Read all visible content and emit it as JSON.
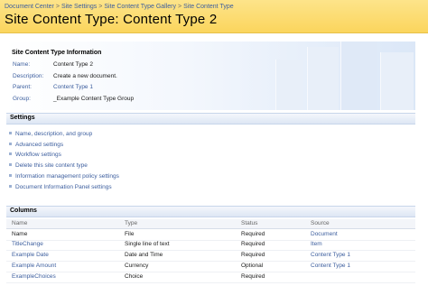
{
  "breadcrumb": {
    "items": [
      "Document Center",
      "Site Settings",
      "Site Content Type Gallery",
      "Site Content Type"
    ],
    "separator": ">"
  },
  "page_title": "Site Content Type: Content Type 2",
  "info": {
    "title": "Site Content Type Information",
    "rows": [
      {
        "label": "Name:",
        "value": "Content Type 2"
      },
      {
        "label": "Description:",
        "value": "Create a new document."
      },
      {
        "label": "Parent:",
        "value": "Content Type 1"
      },
      {
        "label": "Group:",
        "value": "_Example Content Type Group"
      }
    ]
  },
  "settings": {
    "title": "Settings",
    "items": [
      "Name, description, and group",
      "Advanced settings",
      "Workflow settings",
      "Delete this site content type",
      "Information management policy settings",
      "Document Information Panel settings"
    ]
  },
  "columns": {
    "title": "Columns",
    "headers": [
      "Name",
      "Type",
      "Status",
      "Source"
    ],
    "rows": [
      [
        "Name",
        "File",
        "Required",
        "Document"
      ],
      [
        "TitleChange",
        "Single line of text",
        "Required",
        "Item"
      ],
      [
        "Example Date",
        "Date and Time",
        "Required",
        "Content Type 1"
      ],
      [
        "Example Amount",
        "Currency",
        "Optional",
        "Content Type 1"
      ],
      [
        "ExampleChoices",
        "Choice",
        "Required",
        ""
      ]
    ]
  },
  "colors": {
    "header_bg": "#fbd55d",
    "link": "#3c5e9e",
    "section_bar": "#dde6f4"
  }
}
